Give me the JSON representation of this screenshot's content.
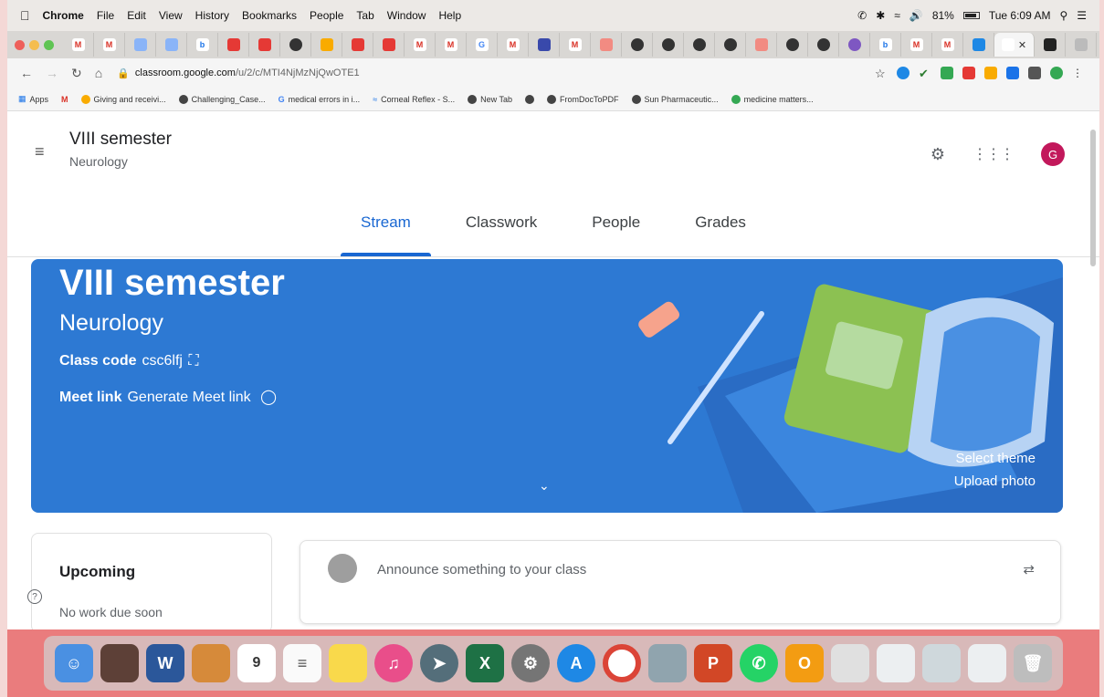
{
  "menubar": {
    "app": "Chrome",
    "items": [
      "File",
      "Edit",
      "View",
      "History",
      "Bookmarks",
      "People",
      "Tab",
      "Window",
      "Help"
    ],
    "battery": "81%",
    "clock": "Tue 6:09 AM"
  },
  "browser": {
    "url_host": "classroom.google.com",
    "url_path": "/u/2/c/MTI4NjMzNjQwOTE1",
    "bookmarks": [
      "Apps",
      "Giving and receivi...",
      "Challenging_Case...",
      "medical errors in i...",
      "Corneal Reflex - S...",
      "New Tab",
      "FromDocToPDF",
      "Sun Pharmaceutic...",
      "medicine matters..."
    ]
  },
  "header": {
    "title": "VIII semester",
    "subtitle": "Neurology",
    "avatar_letter": "G"
  },
  "tabs": [
    {
      "label": "Stream",
      "active": true
    },
    {
      "label": "Classwork",
      "active": false
    },
    {
      "label": "People",
      "active": false
    },
    {
      "label": "Grades",
      "active": false
    }
  ],
  "banner": {
    "title": "VIII semester",
    "subtitle": "Neurology",
    "class_code_label": "Class code",
    "class_code_value": "csc6lfj",
    "meet_label": "Meet link",
    "meet_value": "Generate Meet link",
    "select_theme": "Select theme",
    "upload_photo": "Upload photo",
    "color": "#2d79d3"
  },
  "upcoming": {
    "title": "Upcoming",
    "empty_text": "No work due soon"
  },
  "announce": {
    "placeholder": "Announce something to your class"
  },
  "colors": {
    "accent": "#1967d2",
    "avatar": "#c2185b"
  }
}
